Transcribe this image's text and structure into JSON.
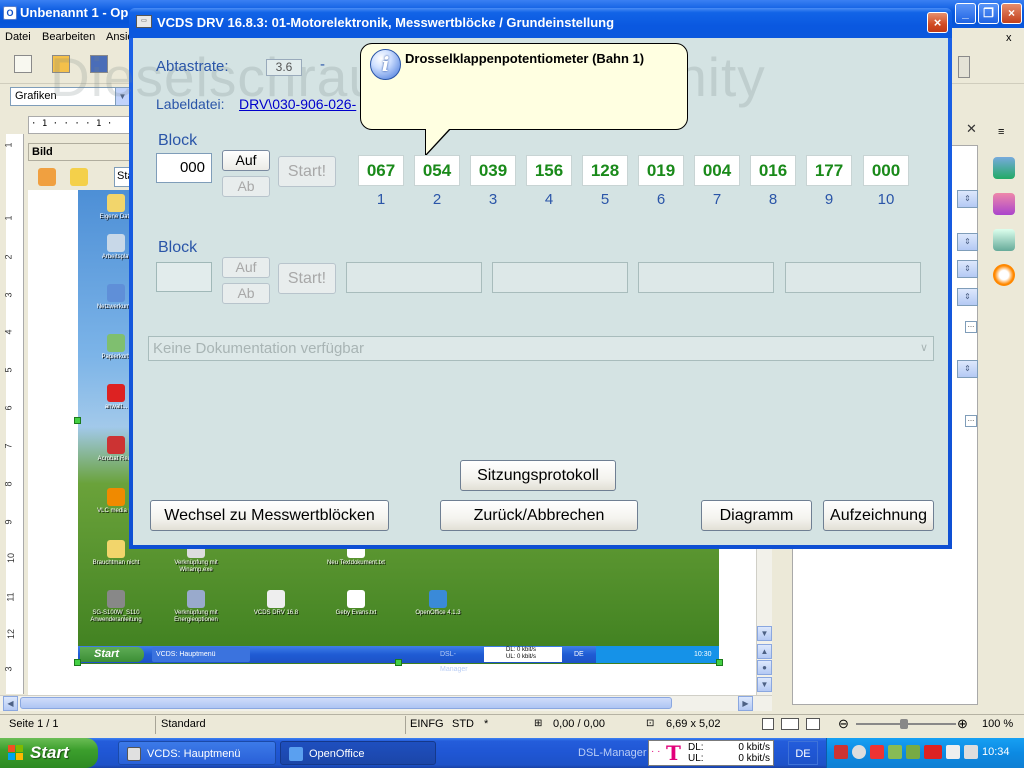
{
  "openoffice": {
    "title": "Unbenannt 1 - Op",
    "menu": [
      "Datei",
      "Bearbeiten",
      "Ansich"
    ],
    "help_close": "x",
    "style_box": "Grafiken",
    "ruler_text": "· 1 · · · · 1 ·",
    "bild_toolbar_label": "Bild",
    "bild_combo": "Sta",
    "vruler_numbers": [
      "1",
      "1",
      "2",
      "3",
      "4",
      "5",
      "6",
      "7",
      "8",
      "9",
      "10",
      "11",
      "12",
      "3"
    ],
    "status": {
      "page": "Seite 1 / 1",
      "style": "Standard",
      "mode": "EINFG",
      "sel": "STD",
      "star": "*",
      "position": "0,00 / 0,00",
      "size": "6,69 x 5,02",
      "zoom": "100 %"
    }
  },
  "embedded_desktop": {
    "icons": [
      "Eigene Date",
      "Arbeitsplat",
      "Netzwerkumg.",
      "Papierkorb",
      "anwalt...",
      "Acrobat Read",
      "VLC media pl.",
      "Brauchtman nicht",
      "Verknüpfung mit Winamp.exe",
      "Neu Textdokument.txt",
      "SG-S100W_S110 Anwenderanleitung",
      "Verknüpfung mit Energieoptionen",
      "VCDS DRV 16.8",
      "Geby Evans.txt",
      "OpenOffice 4.1.3"
    ],
    "start": "Start",
    "task": "VCDS: Hauptmenü",
    "dsl": "DSL-Manager",
    "dl": "DL: 0 kbit/s",
    "ul": "UL: 0 kbit/s",
    "lang": "DE",
    "clock": "10:30"
  },
  "vcds": {
    "title": "VCDS DRV 16.8.3: 01-Motorelektronik,  Messwertblöcke / Grundeinstellung",
    "close": "×",
    "watermark": "Dieselschrauber Community",
    "abtastrate_label": "Abtastrate:",
    "abtastrate_value": "3.6",
    "abtastrate_dash": "-",
    "labeldatei_label": "Labeldatei:",
    "labeldatei_link": "DRV\\030-906-026-",
    "tooltip": "Drosselklappenpotentiometer (Bahn 1)",
    "block1": {
      "label": "Block",
      "value": "000",
      "up": "Auf",
      "down": "Ab",
      "start": "Start!",
      "values": [
        "067",
        "054",
        "039",
        "156",
        "128",
        "019",
        "004",
        "016",
        "177",
        "000"
      ],
      "indices": [
        "1",
        "2",
        "3",
        "4",
        "5",
        "6",
        "7",
        "8",
        "9",
        "10"
      ]
    },
    "block2": {
      "label": "Block",
      "value": "",
      "up": "Auf",
      "down": "Ab",
      "start": "Start!"
    },
    "documentation": "Keine Dokumentation verfügbar",
    "buttons": {
      "session_log": "Sitzungsprotokoll",
      "switch": "Wechsel zu Messwertblöcken",
      "back": "Zurück/Abbrechen",
      "diagram": "Diagramm",
      "record": "Aufzeichnung"
    }
  },
  "taskbar": {
    "start": "Start",
    "tasks": [
      {
        "label": "VCDS:  Hauptmenü",
        "icon": "vcds-icon"
      },
      {
        "label": "OpenOffice",
        "icon": "openoffice-icon"
      }
    ],
    "dsl_label": "DSL-Manager",
    "dsl_t": "T",
    "dl_label": "DL:",
    "dl_value": "0 kbit/s",
    "ul_label": "UL:",
    "ul_value": "0 kbit/s",
    "lang": "DE",
    "clock": "10:34"
  },
  "colors": {
    "xp_blue": "#0a58e0",
    "dialog_bg": "#d4e3e3",
    "value_green": "#1a8a1a",
    "label_blue": "#2a55a8",
    "telekom_magenta": "#e2007a"
  }
}
